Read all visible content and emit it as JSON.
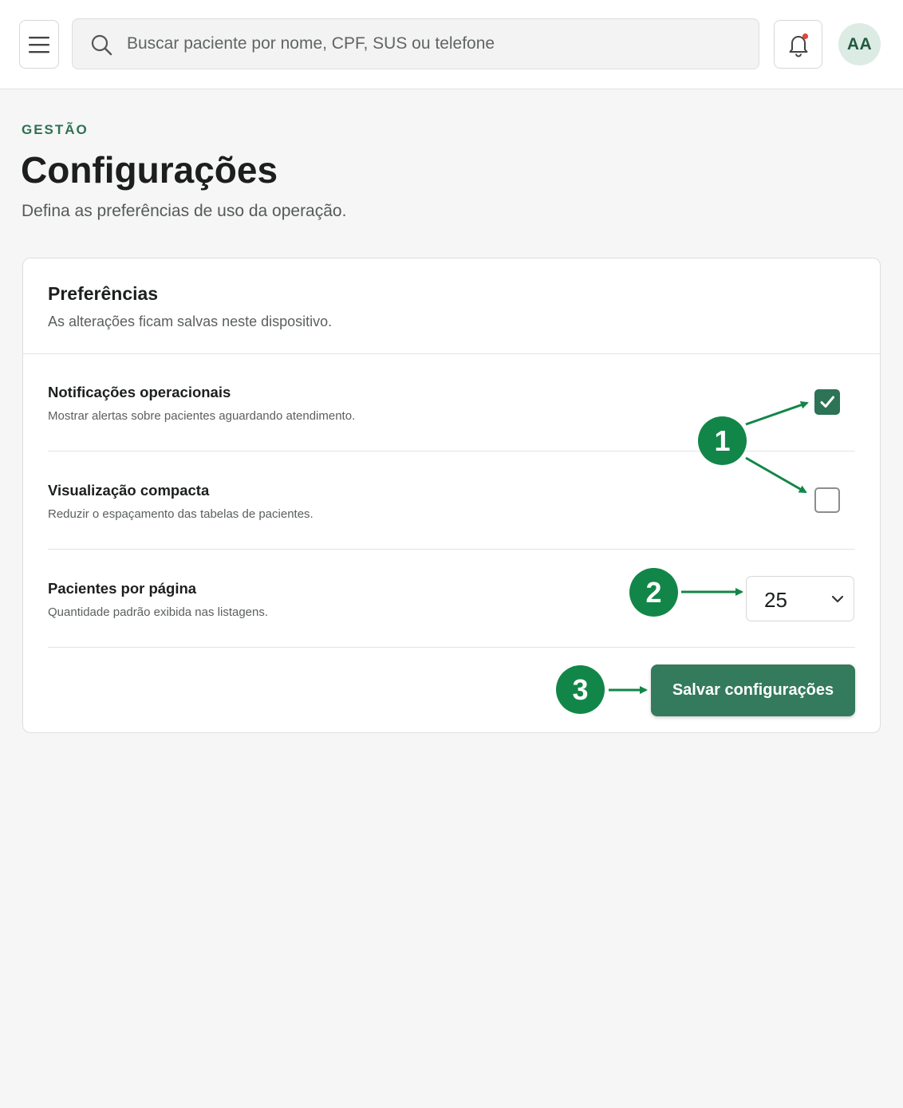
{
  "header": {
    "menu_icon": "hamburger-menu-icon",
    "search": {
      "placeholder": "Buscar paciente por nome, CPF, SUS ou telefone",
      "value": "",
      "icon": "search-icon"
    },
    "notifications_icon": "bell-icon",
    "notification_dot_color": "#e0473c",
    "avatar_initials": "AA"
  },
  "page": {
    "eyebrow": "GESTÃO",
    "title": "Configurações",
    "subtitle": "Defina as preferências de uso da operação."
  },
  "card": {
    "title": "Preferências",
    "subtitle": "As alterações ficam salvas neste dispositivo.",
    "settings": [
      {
        "title": "Notificações operacionais",
        "description": "Mostrar alertas sobre pacientes aguardando atendimento.",
        "checked": true
      },
      {
        "title": "Visualização compacta",
        "description": "Reduzir o espaçamento das tabelas de pacientes.",
        "checked": false
      },
      {
        "title": "Pacientes por página",
        "description": "Quantidade padrão exibida nas listagens.",
        "selected": "25"
      }
    ],
    "save_label": "Salvar configurações"
  },
  "annotations": {
    "badge_1": "1",
    "badge_2": "2",
    "badge_3": "3"
  },
  "colors": {
    "accent": "#2d7356",
    "annotation": "#128648",
    "eyebrow": "#2f7153"
  }
}
